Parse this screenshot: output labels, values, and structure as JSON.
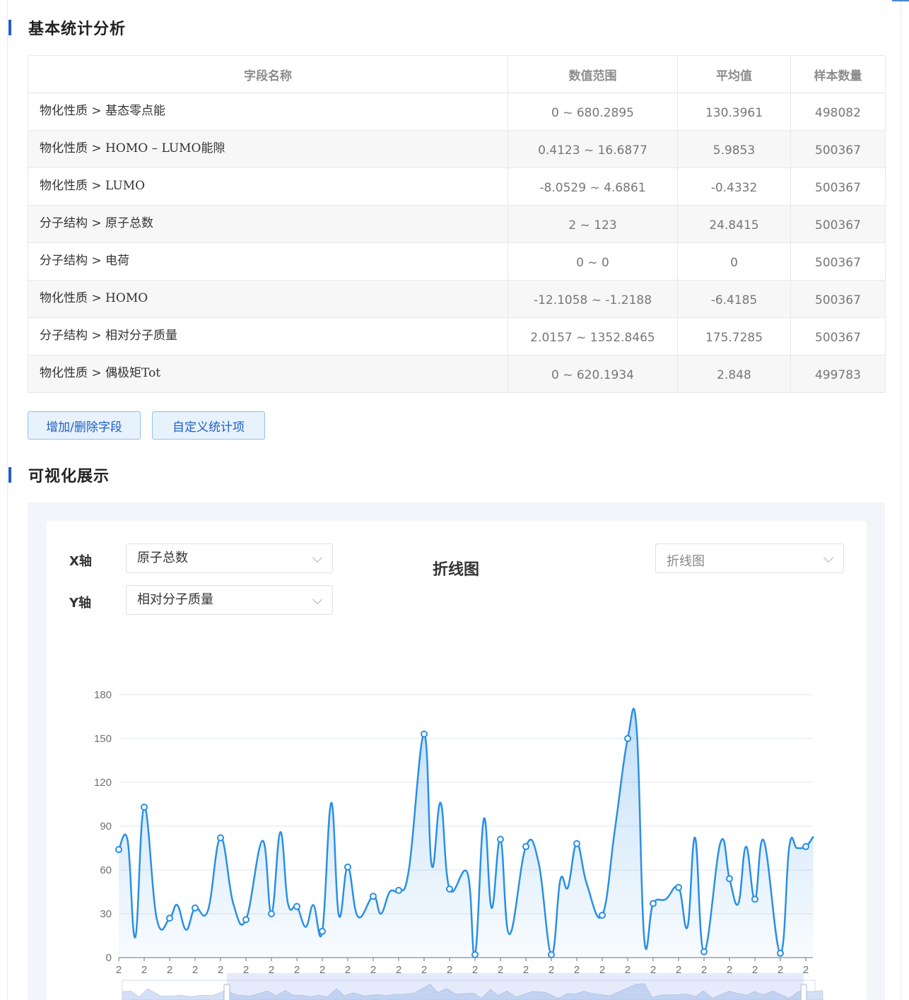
{
  "sections": {
    "stats_title": "基本统计分析",
    "viz_title": "可视化展示"
  },
  "table": {
    "headers": [
      "字段名称",
      "数值范围",
      "平均值",
      "样本数量"
    ],
    "rows": [
      {
        "name": "物化性质 > 基态零点能",
        "range": "0 ~ 680.2895",
        "mean": "130.3961",
        "count": "498082"
      },
      {
        "name": "物化性质 > HOMO – LUMO能隙",
        "range": "0.4123 ~ 16.6877",
        "mean": "5.9853",
        "count": "500367"
      },
      {
        "name": "物化性质 > LUMO",
        "range": "-8.0529 ~ 4.6861",
        "mean": "-0.4332",
        "count": "500367"
      },
      {
        "name": "分子结构 > 原子总数",
        "range": "2 ~ 123",
        "mean": "24.8415",
        "count": "500367"
      },
      {
        "name": "分子结构 > 电荷",
        "range": "0 ~ 0",
        "mean": "0",
        "count": "500367"
      },
      {
        "name": "物化性质 > HOMO",
        "range": "-12.1058 ~ -1.2188",
        "mean": "-6.4185",
        "count": "500367"
      },
      {
        "name": "分子结构 > 相对分子质量",
        "range": "2.0157 ~ 1352.8465",
        "mean": "175.7285",
        "count": "500367"
      },
      {
        "name": "物化性质 > 偶极矩Tot",
        "range": "0 ~ 620.1934",
        "mean": "2.848",
        "count": "499783"
      }
    ]
  },
  "buttons": {
    "add_remove": "增加/删除字段",
    "custom_stats": "自定义统计项"
  },
  "controls": {
    "x_label": "X轴",
    "y_label": "Y轴",
    "x_value": "原子总数",
    "y_value": "相对分子质量",
    "chart_type_value": "折线图"
  },
  "chart_data": {
    "type": "line",
    "title": "折线图",
    "smooth": true,
    "area_fill": true,
    "color": "#2a8fe6",
    "ylim": [
      0,
      180
    ],
    "yticks": [
      0,
      30,
      60,
      90,
      120,
      150,
      180
    ],
    "x_tick_labels": [
      "2",
      "2",
      "2",
      "2",
      "2",
      "2",
      "2",
      "2",
      "2",
      "2",
      "2",
      "2",
      "2",
      "2",
      "2",
      "2",
      "2",
      "2",
      "2",
      "2",
      "2",
      "2",
      "2",
      "2",
      "2",
      "2",
      "2",
      "2"
    ],
    "grid": true,
    "points": [
      {
        "x": 0,
        "y": 74,
        "marker": true
      },
      {
        "x": 0.35,
        "y": 80
      },
      {
        "x": 0.65,
        "y": 14
      },
      {
        "x": 1,
        "y": 103,
        "marker": true
      },
      {
        "x": 1.5,
        "y": 26
      },
      {
        "x": 2,
        "y": 27,
        "marker": true
      },
      {
        "x": 2.3,
        "y": 36
      },
      {
        "x": 2.65,
        "y": 19
      },
      {
        "x": 3,
        "y": 34,
        "marker": true
      },
      {
        "x": 3.5,
        "y": 32
      },
      {
        "x": 4,
        "y": 82,
        "marker": true
      },
      {
        "x": 4.5,
        "y": 37
      },
      {
        "x": 5,
        "y": 26,
        "marker": true
      },
      {
        "x": 5.65,
        "y": 80
      },
      {
        "x": 6,
        "y": 30,
        "marker": true
      },
      {
        "x": 6.35,
        "y": 86
      },
      {
        "x": 6.65,
        "y": 37
      },
      {
        "x": 7,
        "y": 35,
        "marker": true
      },
      {
        "x": 7.35,
        "y": 21
      },
      {
        "x": 7.65,
        "y": 36
      },
      {
        "x": 8,
        "y": 18,
        "marker": true
      },
      {
        "x": 8.35,
        "y": 106
      },
      {
        "x": 8.65,
        "y": 29
      },
      {
        "x": 9,
        "y": 62,
        "marker": true
      },
      {
        "x": 9.4,
        "y": 28
      },
      {
        "x": 10,
        "y": 42,
        "marker": true
      },
      {
        "x": 10.3,
        "y": 30
      },
      {
        "x": 10.65,
        "y": 45
      },
      {
        "x": 11,
        "y": 46,
        "marker": true
      },
      {
        "x": 11.4,
        "y": 60
      },
      {
        "x": 12,
        "y": 153,
        "marker": true
      },
      {
        "x": 12.3,
        "y": 63
      },
      {
        "x": 12.65,
        "y": 106
      },
      {
        "x": 13,
        "y": 47,
        "marker": true
      },
      {
        "x": 13.7,
        "y": 58
      },
      {
        "x": 14,
        "y": 2,
        "marker": true
      },
      {
        "x": 14.35,
        "y": 95
      },
      {
        "x": 14.65,
        "y": 34
      },
      {
        "x": 15,
        "y": 81,
        "marker": true
      },
      {
        "x": 15.35,
        "y": 16
      },
      {
        "x": 16,
        "y": 76,
        "marker": true
      },
      {
        "x": 16.5,
        "y": 65
      },
      {
        "x": 17,
        "y": 2,
        "marker": true
      },
      {
        "x": 17.35,
        "y": 53
      },
      {
        "x": 17.65,
        "y": 48
      },
      {
        "x": 18,
        "y": 78,
        "marker": true
      },
      {
        "x": 18.4,
        "y": 50
      },
      {
        "x": 19,
        "y": 29,
        "marker": true
      },
      {
        "x": 19.5,
        "y": 88
      },
      {
        "x": 20,
        "y": 150,
        "marker": true
      },
      {
        "x": 20.35,
        "y": 157
      },
      {
        "x": 20.65,
        "y": 13
      },
      {
        "x": 21,
        "y": 37,
        "marker": true
      },
      {
        "x": 21.5,
        "y": 40
      },
      {
        "x": 22,
        "y": 48,
        "marker": true
      },
      {
        "x": 22.35,
        "y": 21
      },
      {
        "x": 22.65,
        "y": 82
      },
      {
        "x": 23,
        "y": 4,
        "marker": true
      },
      {
        "x": 23.65,
        "y": 79
      },
      {
        "x": 24,
        "y": 54,
        "marker": true
      },
      {
        "x": 24.35,
        "y": 37
      },
      {
        "x": 24.65,
        "y": 76
      },
      {
        "x": 25,
        "y": 40,
        "marker": true
      },
      {
        "x": 25.35,
        "y": 80
      },
      {
        "x": 26,
        "y": 3,
        "marker": true
      },
      {
        "x": 26.35,
        "y": 76
      },
      {
        "x": 26.65,
        "y": 75
      },
      {
        "x": 27,
        "y": 76,
        "marker": true
      },
      {
        "x": 27.3,
        "y": 83
      }
    ],
    "datazoom": true
  }
}
